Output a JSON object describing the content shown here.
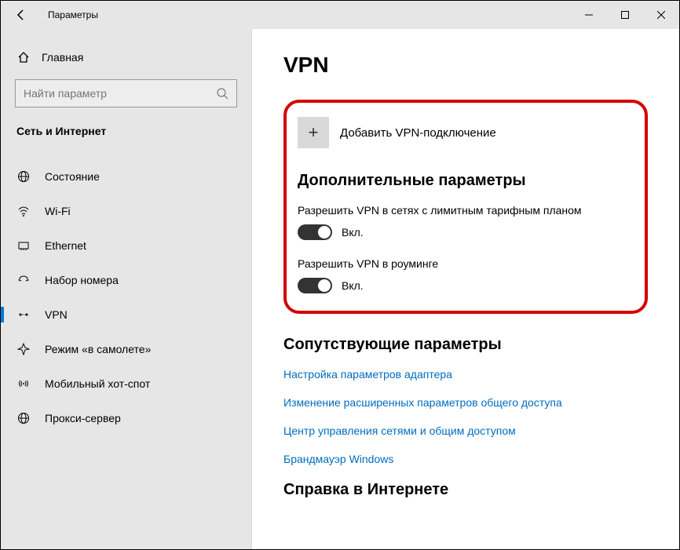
{
  "titlebar": {
    "title": "Параметры"
  },
  "sidebar": {
    "home": "Главная",
    "search_placeholder": "Найти параметр",
    "section": "Сеть и Интернет",
    "items": [
      {
        "label": "Состояние"
      },
      {
        "label": "Wi-Fi"
      },
      {
        "label": "Ethernet"
      },
      {
        "label": "Набор номера"
      },
      {
        "label": "VPN"
      },
      {
        "label": "Режим «в самолете»"
      },
      {
        "label": "Мобильный хот-спот"
      },
      {
        "label": "Прокси-сервер"
      }
    ]
  },
  "main": {
    "heading": "VPN",
    "add_vpn": "Добавить VPN-подключение",
    "advanced_heading": "Дополнительные параметры",
    "allow_metered_label": "Разрешить VPN в сетях с лимитным тарифным планом",
    "allow_metered_state": "Вкл.",
    "allow_roaming_label": "Разрешить VPN в роуминге",
    "allow_roaming_state": "Вкл.",
    "related_heading": "Сопутствующие параметры",
    "related_links": [
      "Настройка параметров адаптера",
      "Изменение расширенных параметров общего доступа",
      "Центр управления сетями и общим доступом",
      "Брандмауэр Windows"
    ],
    "help_heading_partial": "Справка в Интернете"
  }
}
